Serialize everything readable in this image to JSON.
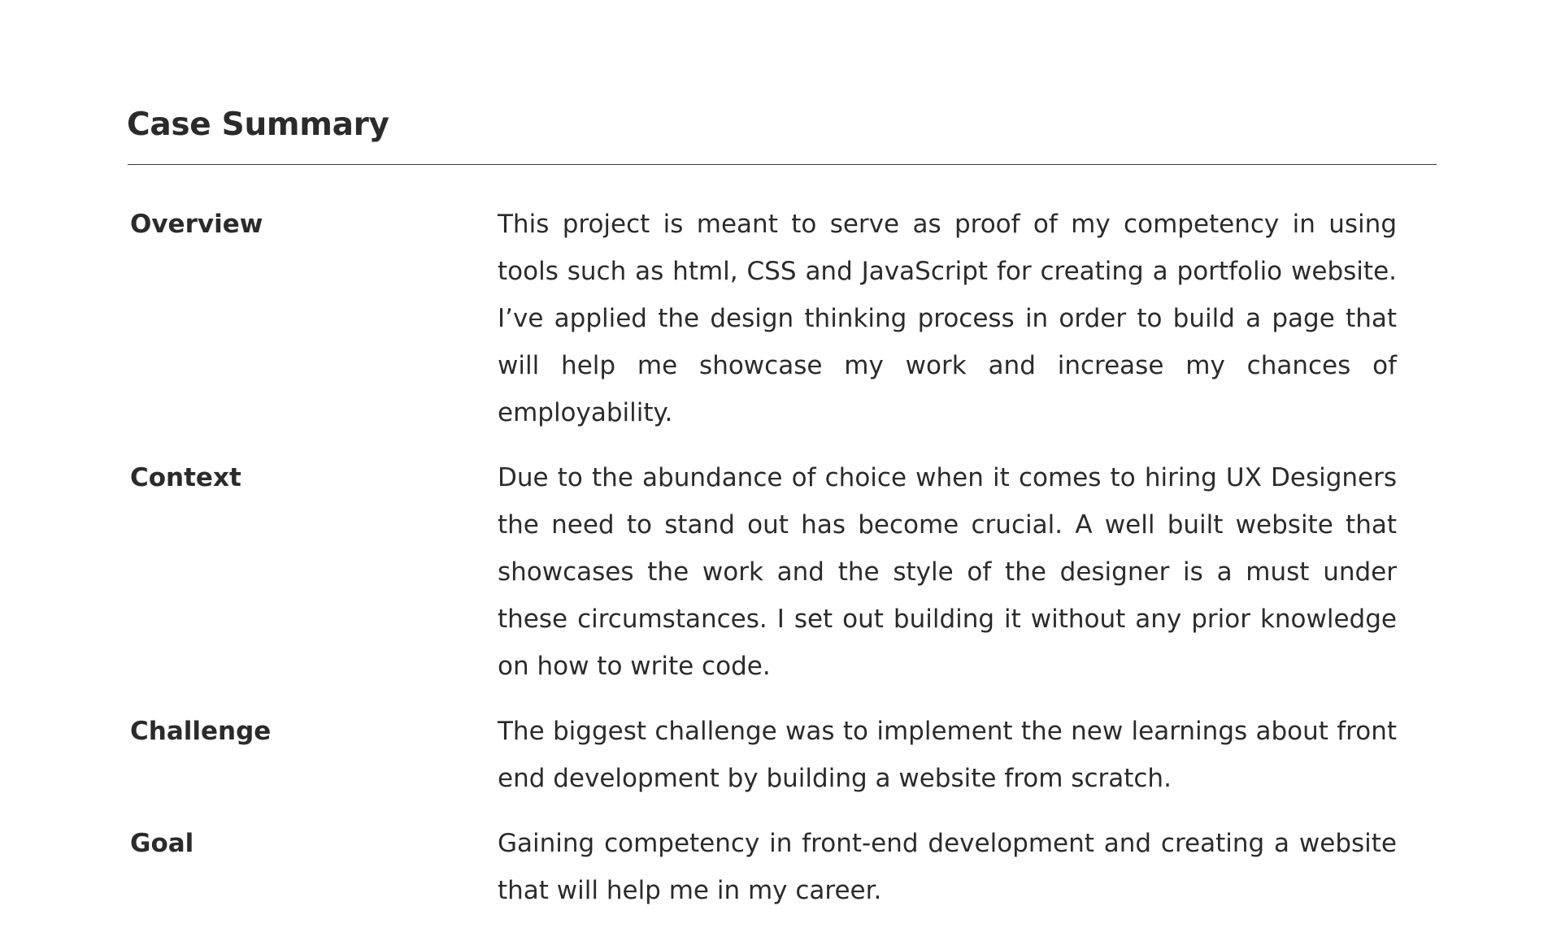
{
  "case_summary": {
    "title": "Case Summary",
    "rows": [
      {
        "label": "Overview",
        "text": "This project is meant to serve as proof of my competency in using tools such as html, CSS and JavaScript for creating a portfolio website. I’ve applied the design thinking process in order to build a page that will help me showcase my work and increase my chances of employability."
      },
      {
        "label": "Context",
        "text": "Due to the abundance of choice when it comes to hiring UX Designers the need to stand out has become crucial. A well built website that showcases the work and the style of the designer is a must under these circumstances. I set out building it without any prior knowledge on how to write code."
      },
      {
        "label": "Challenge",
        "text": "The biggest challenge was to implement the new learnings about front end development by building a website from scratch."
      },
      {
        "label": "Goal",
        "text": "Gaining competency in front-end development and creating a website that will help me in my career."
      }
    ]
  }
}
